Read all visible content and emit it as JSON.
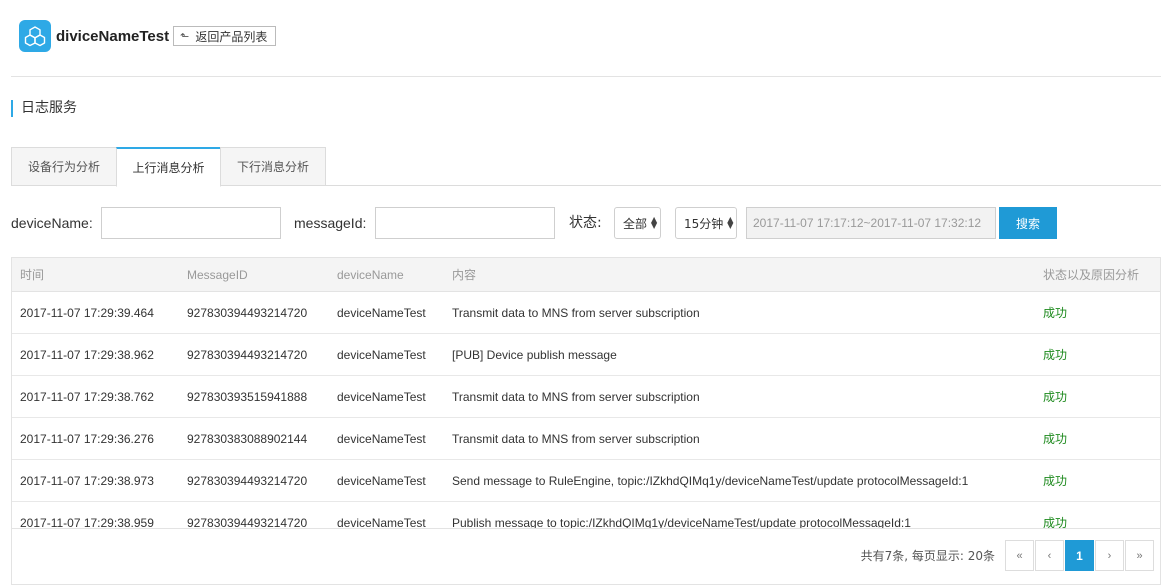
{
  "header": {
    "product_name": "diviceNameTest",
    "back_label": "返回产品列表",
    "logo_icon": "product-cube-icon",
    "accent_color": "#2ea9e6"
  },
  "section": {
    "title": "日志服务"
  },
  "tabs": [
    {
      "label": "设备行为分析",
      "active": false
    },
    {
      "label": "上行消息分析",
      "active": true
    },
    {
      "label": "下行消息分析",
      "active": false
    }
  ],
  "filters": {
    "device_name_label": "deviceName:",
    "device_name_value": "",
    "message_id_label": "messageId:",
    "message_id_value": "",
    "status_label": "状态:",
    "status_value": "全部",
    "time_value": "15分钟",
    "range_value": "2017-11-07 17:17:12~2017-11-07 17:32:12",
    "search_label": "搜索"
  },
  "table": {
    "headers": [
      "时间",
      "MessageID",
      "deviceName",
      "内容",
      "状态以及原因分析"
    ],
    "rows": [
      [
        "2017-11-07 17:29:39.464",
        "927830394493214720",
        "deviceNameTest",
        "Transmit data to MNS from server subscription",
        "成功"
      ],
      [
        "2017-11-07 17:29:38.962",
        "927830394493214720",
        "deviceNameTest",
        "[PUB] Device publish message",
        "成功"
      ],
      [
        "2017-11-07 17:29:38.762",
        "927830393515941888",
        "deviceNameTest",
        "Transmit data to MNS from server subscription",
        "成功"
      ],
      [
        "2017-11-07 17:29:36.276",
        "927830383088902144",
        "deviceNameTest",
        "Transmit data to MNS from server subscription",
        "成功"
      ],
      [
        "2017-11-07 17:29:38.973",
        "927830394493214720",
        "deviceNameTest",
        "Send message to RuleEngine, topic:/IZkhdQIMq1y/deviceNameTest/update protocolMessageId:1",
        "成功"
      ],
      [
        "2017-11-07 17:29:38.959",
        "927830394493214720",
        "deviceNameTest",
        "Publish message to topic:/IZkhdQIMq1y/deviceNameTest/update protocolMessageId:1",
        "成功"
      ]
    ],
    "status_color": "#1e8a1e"
  },
  "pagination": {
    "summary": "共有7条,  每页显示: 20条",
    "first": "«",
    "prev": "‹",
    "current": "1",
    "next": "›",
    "last": "»"
  }
}
